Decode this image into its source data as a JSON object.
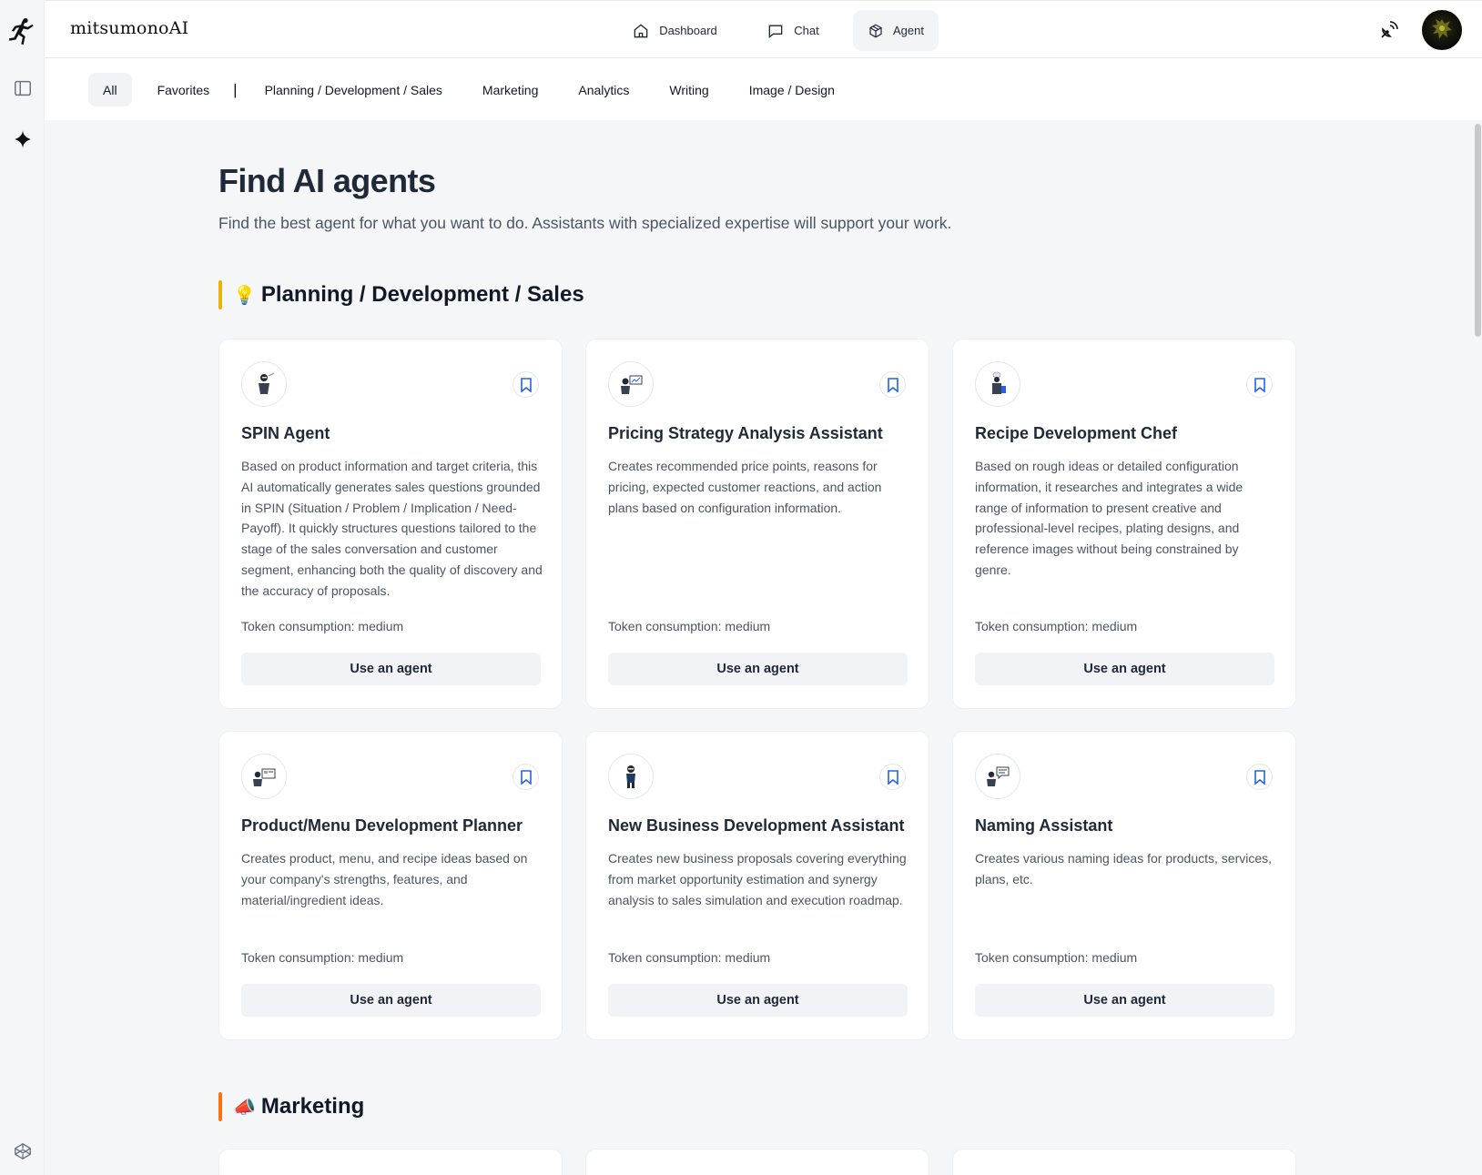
{
  "app": {
    "brand": "mitsumonoAI"
  },
  "rail": {
    "logo_icon": "running-figure-logo",
    "items": [
      {
        "icon": "sidebar-toggle-icon"
      },
      {
        "icon": "sparkle-icon"
      },
      {
        "icon": "codepen-cube-icon"
      }
    ]
  },
  "nav": {
    "dashboard": "Dashboard",
    "chat": "Chat",
    "agent": "Agent",
    "active": "Agent"
  },
  "header": {
    "right_icon": "satellite-dish-icon",
    "avatar": "user-avatar"
  },
  "tabs": {
    "all": "All",
    "favorites": "Favorites",
    "separator": "|",
    "planning": "Planning / Development / Sales",
    "marketing": "Marketing",
    "analytics": "Analytics",
    "writing": "Writing",
    "image": "Image / Design",
    "active": "All"
  },
  "page": {
    "title": "Find AI agents",
    "subtitle": "Find the best agent for what you want to do. Assistants with specialized expertise will support your work."
  },
  "colors": {
    "planning_accent": "#eab308",
    "marketing_accent": "#f97316",
    "bookmark": "#2563eb"
  },
  "sections": [
    {
      "emoji": "💡",
      "title": "Planning / Development / Sales",
      "cards": [
        {
          "name": "SPIN Agent",
          "description": "Based on product information and target criteria, this AI automatically generates sales questions grounded in SPIN (Situation / Problem / Implication / Need-Payoff). It quickly structures questions tailored to the stage of the sales conversation and customer segment, enhancing both the quality of discovery and the accuracy of proposals.",
          "token": "Token consumption: medium",
          "button": "Use an agent",
          "icon": "ninja-salesperson-icon"
        },
        {
          "name": "Pricing Strategy Analysis Assistant",
          "description": "Creates recommended price points, reasons for pricing, expected customer reactions, and action plans based on configuration information.",
          "token": "Token consumption: medium",
          "button": "Use an agent",
          "icon": "ninja-chart-icon"
        },
        {
          "name": "Recipe Development Chef",
          "description": "Based on rough ideas or detailed configuration information, it researches and integrates a wide range of information to present creative and professional-level recipes, plating designs, and reference images without being constrained by genre.",
          "token": "Token consumption: medium",
          "button": "Use an agent",
          "icon": "ninja-chef-icon"
        },
        {
          "name": "Product/Menu Development Planner",
          "description": "Creates product, menu, and recipe ideas based on your company's strengths, features, and material/ingredient ideas.",
          "token": "Token consumption: medium",
          "button": "Use an agent",
          "icon": "ninja-board-icon"
        },
        {
          "name": "New Business Development Assistant",
          "description": "Creates new business proposals covering everything from market opportunity estimation and synergy analysis to sales simulation and execution roadmap.",
          "token": "Token consumption: medium",
          "button": "Use an agent",
          "icon": "ninja-standing-icon"
        },
        {
          "name": "Naming Assistant",
          "description": "Creates various naming ideas for products, services, plans, etc.",
          "token": "Token consumption: medium",
          "button": "Use an agent",
          "icon": "ninja-speech-icon"
        }
      ]
    },
    {
      "emoji": "📣",
      "title": "Marketing",
      "cards": []
    }
  ]
}
